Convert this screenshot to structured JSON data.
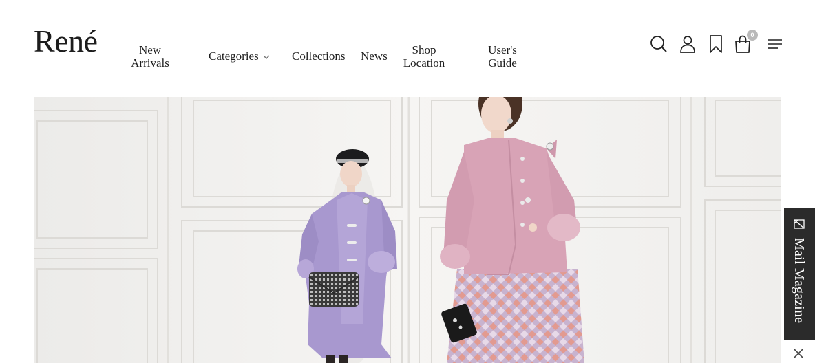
{
  "brand": {
    "logo": "René"
  },
  "nav": {
    "new_arrivals": "New Arrivals",
    "categories": "Categories",
    "collections": "Collections",
    "news": "News",
    "shop_location": "Shop Location",
    "users_guide": "User's Guide"
  },
  "header_icons": {
    "search": "search-icon",
    "account": "user-icon",
    "wishlist": "bookmark-icon",
    "cart": "shopping-bag-icon",
    "menu": "hamburger-menu-icon",
    "cart_count": "0"
  },
  "hero": {
    "image": "two models in lavender coat and pink jacket against white paneled wall"
  },
  "mail_magazine": {
    "label": "Mail Magazine",
    "icon": "mail-icon",
    "close_icon": "close-icon"
  },
  "colors": {
    "text": "#1e1e1e",
    "mail_tab_bg": "#2b2b2b",
    "badge": "#b9b9b9",
    "hero_bg": "#f1f0ee"
  }
}
